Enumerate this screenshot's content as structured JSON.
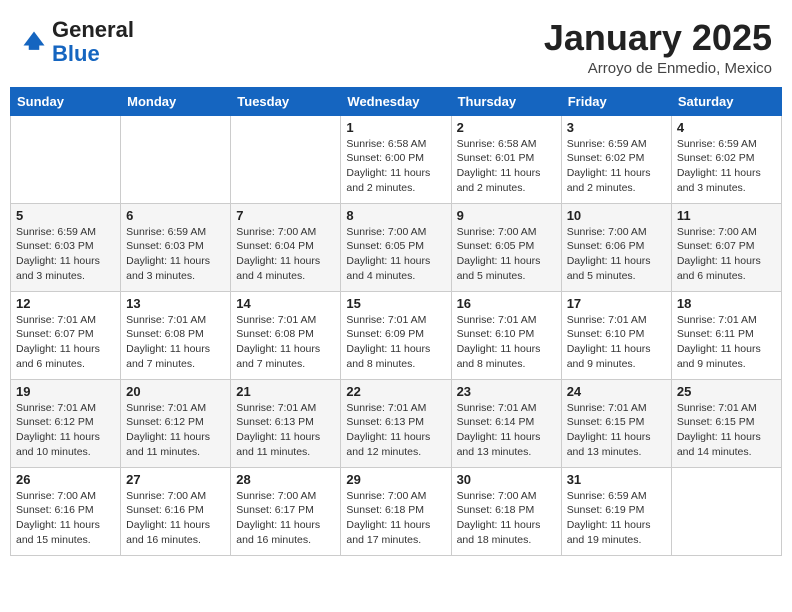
{
  "header": {
    "logo_general": "General",
    "logo_blue": "Blue",
    "month_title": "January 2025",
    "location": "Arroyo de Enmedio, Mexico"
  },
  "days_of_week": [
    "Sunday",
    "Monday",
    "Tuesday",
    "Wednesday",
    "Thursday",
    "Friday",
    "Saturday"
  ],
  "weeks": [
    [
      {
        "day": "",
        "info": ""
      },
      {
        "day": "",
        "info": ""
      },
      {
        "day": "",
        "info": ""
      },
      {
        "day": "1",
        "info": "Sunrise: 6:58 AM\nSunset: 6:00 PM\nDaylight: 11 hours\nand 2 minutes."
      },
      {
        "day": "2",
        "info": "Sunrise: 6:58 AM\nSunset: 6:01 PM\nDaylight: 11 hours\nand 2 minutes."
      },
      {
        "day": "3",
        "info": "Sunrise: 6:59 AM\nSunset: 6:02 PM\nDaylight: 11 hours\nand 2 minutes."
      },
      {
        "day": "4",
        "info": "Sunrise: 6:59 AM\nSunset: 6:02 PM\nDaylight: 11 hours\nand 3 minutes."
      }
    ],
    [
      {
        "day": "5",
        "info": "Sunrise: 6:59 AM\nSunset: 6:03 PM\nDaylight: 11 hours\nand 3 minutes."
      },
      {
        "day": "6",
        "info": "Sunrise: 6:59 AM\nSunset: 6:03 PM\nDaylight: 11 hours\nand 3 minutes."
      },
      {
        "day": "7",
        "info": "Sunrise: 7:00 AM\nSunset: 6:04 PM\nDaylight: 11 hours\nand 4 minutes."
      },
      {
        "day": "8",
        "info": "Sunrise: 7:00 AM\nSunset: 6:05 PM\nDaylight: 11 hours\nand 4 minutes."
      },
      {
        "day": "9",
        "info": "Sunrise: 7:00 AM\nSunset: 6:05 PM\nDaylight: 11 hours\nand 5 minutes."
      },
      {
        "day": "10",
        "info": "Sunrise: 7:00 AM\nSunset: 6:06 PM\nDaylight: 11 hours\nand 5 minutes."
      },
      {
        "day": "11",
        "info": "Sunrise: 7:00 AM\nSunset: 6:07 PM\nDaylight: 11 hours\nand 6 minutes."
      }
    ],
    [
      {
        "day": "12",
        "info": "Sunrise: 7:01 AM\nSunset: 6:07 PM\nDaylight: 11 hours\nand 6 minutes."
      },
      {
        "day": "13",
        "info": "Sunrise: 7:01 AM\nSunset: 6:08 PM\nDaylight: 11 hours\nand 7 minutes."
      },
      {
        "day": "14",
        "info": "Sunrise: 7:01 AM\nSunset: 6:08 PM\nDaylight: 11 hours\nand 7 minutes."
      },
      {
        "day": "15",
        "info": "Sunrise: 7:01 AM\nSunset: 6:09 PM\nDaylight: 11 hours\nand 8 minutes."
      },
      {
        "day": "16",
        "info": "Sunrise: 7:01 AM\nSunset: 6:10 PM\nDaylight: 11 hours\nand 8 minutes."
      },
      {
        "day": "17",
        "info": "Sunrise: 7:01 AM\nSunset: 6:10 PM\nDaylight: 11 hours\nand 9 minutes."
      },
      {
        "day": "18",
        "info": "Sunrise: 7:01 AM\nSunset: 6:11 PM\nDaylight: 11 hours\nand 9 minutes."
      }
    ],
    [
      {
        "day": "19",
        "info": "Sunrise: 7:01 AM\nSunset: 6:12 PM\nDaylight: 11 hours\nand 10 minutes."
      },
      {
        "day": "20",
        "info": "Sunrise: 7:01 AM\nSunset: 6:12 PM\nDaylight: 11 hours\nand 11 minutes."
      },
      {
        "day": "21",
        "info": "Sunrise: 7:01 AM\nSunset: 6:13 PM\nDaylight: 11 hours\nand 11 minutes."
      },
      {
        "day": "22",
        "info": "Sunrise: 7:01 AM\nSunset: 6:13 PM\nDaylight: 11 hours\nand 12 minutes."
      },
      {
        "day": "23",
        "info": "Sunrise: 7:01 AM\nSunset: 6:14 PM\nDaylight: 11 hours\nand 13 minutes."
      },
      {
        "day": "24",
        "info": "Sunrise: 7:01 AM\nSunset: 6:15 PM\nDaylight: 11 hours\nand 13 minutes."
      },
      {
        "day": "25",
        "info": "Sunrise: 7:01 AM\nSunset: 6:15 PM\nDaylight: 11 hours\nand 14 minutes."
      }
    ],
    [
      {
        "day": "26",
        "info": "Sunrise: 7:00 AM\nSunset: 6:16 PM\nDaylight: 11 hours\nand 15 minutes."
      },
      {
        "day": "27",
        "info": "Sunrise: 7:00 AM\nSunset: 6:16 PM\nDaylight: 11 hours\nand 16 minutes."
      },
      {
        "day": "28",
        "info": "Sunrise: 7:00 AM\nSunset: 6:17 PM\nDaylight: 11 hours\nand 16 minutes."
      },
      {
        "day": "29",
        "info": "Sunrise: 7:00 AM\nSunset: 6:18 PM\nDaylight: 11 hours\nand 17 minutes."
      },
      {
        "day": "30",
        "info": "Sunrise: 7:00 AM\nSunset: 6:18 PM\nDaylight: 11 hours\nand 18 minutes."
      },
      {
        "day": "31",
        "info": "Sunrise: 6:59 AM\nSunset: 6:19 PM\nDaylight: 11 hours\nand 19 minutes."
      },
      {
        "day": "",
        "info": ""
      }
    ]
  ]
}
